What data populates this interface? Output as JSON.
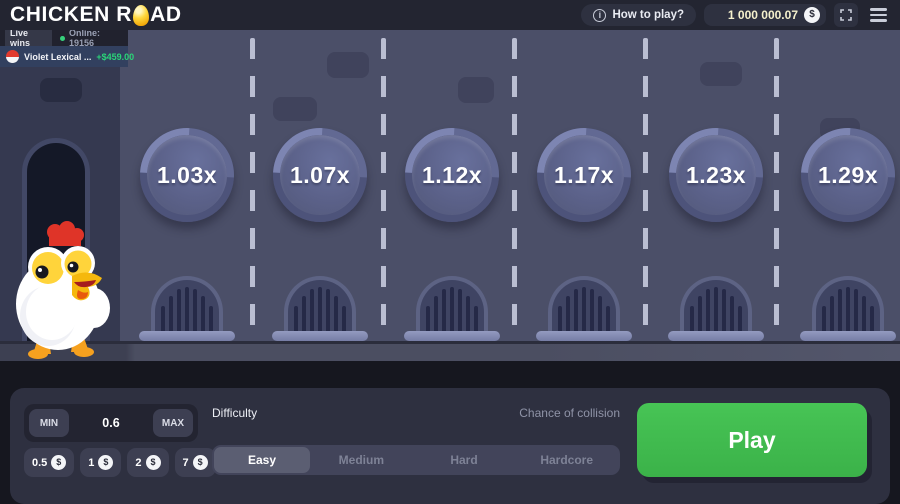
{
  "currency": "$",
  "topbar": {
    "logo_part1": "CHICKEN R",
    "logo_part2": "AD",
    "info_glyph": "i",
    "how_to_play_label": "How to play?",
    "balance": "1 000 000.07"
  },
  "live": {
    "live_wins_label": "Live wins",
    "online_label": "Online: 19156",
    "win": {
      "player": "Violet Lexical ...",
      "amount": "+$459.00"
    }
  },
  "game": {
    "multipliers": [
      "1.03x",
      "1.07x",
      "1.12x",
      "1.17x",
      "1.23x",
      "1.29x"
    ]
  },
  "controls": {
    "bet": {
      "min_label": "MIN",
      "value": "0.6",
      "max_label": "MAX"
    },
    "chips": [
      "0.5",
      "1",
      "2",
      "7"
    ],
    "difficulty_label": "Difficulty",
    "chance_label": "Chance of collision",
    "difficulty_options": [
      "Easy",
      "Medium",
      "Hard",
      "Hardcore"
    ],
    "selected_difficulty": "Easy",
    "play_label": "Play"
  },
  "colors": {
    "accent_green": "#41bd4f",
    "win_green": "#2ad578",
    "balance_yellow": "#f5f1cd",
    "road": "#4b4f68"
  }
}
